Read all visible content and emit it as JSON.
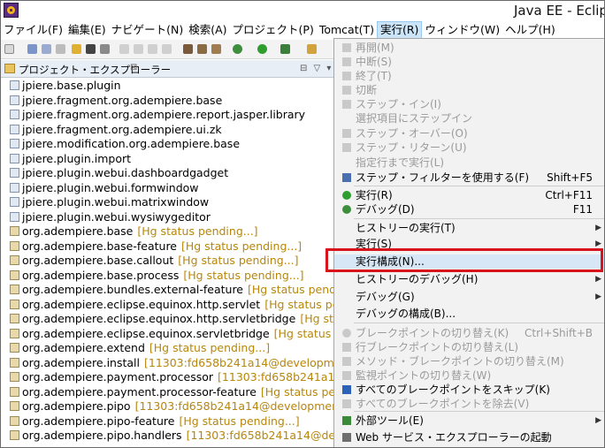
{
  "window": {
    "title": "Java EE - Eclip"
  },
  "menubar": [
    "ファイル(F)",
    "編集(E)",
    "ナビゲート(N)",
    "検索(A)",
    "プロジェクト(P)",
    "Tomcat(T)",
    "実行(R)",
    "ウィンドウ(W)",
    "ヘルプ(H)"
  ],
  "view": {
    "title": "プロジェクト・エクスプローラー",
    "close": "⊠",
    "tools": "⊟ ▽ ▾"
  },
  "tree": [
    {
      "name": "jpiere.base.plugin",
      "status": ""
    },
    {
      "name": "jpiere.fragment.org.adempiere.base",
      "status": ""
    },
    {
      "name": "jpiere.fragment.org.adempiere.report.jasper.library",
      "status": ""
    },
    {
      "name": "jpiere.fragment.org.adempiere.ui.zk",
      "status": ""
    },
    {
      "name": "jpiere.modification.org.adempiere.base",
      "status": ""
    },
    {
      "name": "jpiere.plugin.import",
      "status": ""
    },
    {
      "name": "jpiere.plugin.webui.dashboardgadget",
      "status": ""
    },
    {
      "name": "jpiere.plugin.webui.formwindow",
      "status": ""
    },
    {
      "name": "jpiere.plugin.webui.matrixwindow",
      "status": ""
    },
    {
      "name": "jpiere.plugin.webui.wysiwygeditor",
      "status": ""
    },
    {
      "name": "org.adempiere.base",
      "status": "[Hg status pending...]"
    },
    {
      "name": "org.adempiere.base-feature",
      "status": "[Hg status pending...]"
    },
    {
      "name": "org.adempiere.base.callout",
      "status": "[Hg status pending...]"
    },
    {
      "name": "org.adempiere.base.process",
      "status": "[Hg status pending...]"
    },
    {
      "name": "org.adempiere.bundles.external-feature",
      "status": "[Hg status pending"
    },
    {
      "name": "org.adempiere.eclipse.equinox.http.servlet",
      "status": "[Hg status pendi"
    },
    {
      "name": "org.adempiere.eclipse.equinox.http.servletbridge",
      "status": "[Hg status"
    },
    {
      "name": "org.adempiere.eclipse.equinox.servletbridge",
      "status": "[Hg status pendi"
    },
    {
      "name": "org.adempiere.extend",
      "status": "[Hg status pending...]"
    },
    {
      "name": "org.adempiere.install",
      "status": "[11303:fd658b241a14@development"
    },
    {
      "name": "org.adempiere.payment.processor",
      "status": "[11303:fd658b241a14@d"
    },
    {
      "name": "org.adempiere.payment.processor-feature",
      "status": "[Hg status pend"
    },
    {
      "name": "org.adempiere.pipo",
      "status": "[11303:fd658b241a14@development]"
    },
    {
      "name": "org.adempiere.pipo-feature",
      "status": "[Hg status pending...]"
    },
    {
      "name": "org.adempiere.pipo.handlers",
      "status": "[11303:fd658b241a14@devel"
    }
  ],
  "run_menu": [
    {
      "label": "再開(M)",
      "shortcut": "",
      "submenu": false,
      "disabled": true,
      "icon": "resume-icon"
    },
    {
      "label": "中断(S)",
      "shortcut": "",
      "submenu": false,
      "disabled": true,
      "icon": "suspend-icon"
    },
    {
      "label": "終了(T)",
      "shortcut": "",
      "submenu": false,
      "disabled": true,
      "icon": "terminate-icon"
    },
    {
      "label": "切断",
      "shortcut": "",
      "submenu": false,
      "disabled": true,
      "icon": "disconnect-icon"
    },
    {
      "label": "ステップ・イン(I)",
      "shortcut": "",
      "submenu": false,
      "disabled": true,
      "icon": "step-into-icon"
    },
    {
      "label": "選択項目にステップイン",
      "shortcut": "",
      "submenu": false,
      "disabled": true,
      "icon": ""
    },
    {
      "label": "ステップ・オーバー(O)",
      "shortcut": "",
      "submenu": false,
      "disabled": true,
      "icon": "step-over-icon"
    },
    {
      "label": "ステップ・リターン(U)",
      "shortcut": "",
      "submenu": false,
      "disabled": true,
      "icon": "step-return-icon"
    },
    {
      "label": "指定行まで実行(L)",
      "shortcut": "",
      "submenu": false,
      "disabled": true,
      "icon": ""
    },
    {
      "label": "ステップ・フィルターを使用する(F)",
      "shortcut": "Shift+F5",
      "submenu": false,
      "disabled": false,
      "icon": "step-filter-icon"
    },
    {
      "label": "実行(R)",
      "shortcut": "Ctrl+F11",
      "submenu": false,
      "disabled": false,
      "icon": "run-icon"
    },
    {
      "label": "デバッグ(D)",
      "shortcut": "F11",
      "submenu": false,
      "disabled": false,
      "icon": "debug-icon"
    },
    {
      "label": "ヒストリーの実行(T)",
      "shortcut": "",
      "submenu": true,
      "disabled": false,
      "icon": ""
    },
    {
      "label": "実行(S)",
      "shortcut": "",
      "submenu": true,
      "disabled": false,
      "icon": ""
    },
    {
      "label": "実行構成(N)...",
      "shortcut": "",
      "submenu": false,
      "disabled": false,
      "icon": ""
    },
    {
      "label": "ヒストリーのデバッグ(H)",
      "shortcut": "",
      "submenu": true,
      "disabled": false,
      "icon": ""
    },
    {
      "label": "デバッグ(G)",
      "shortcut": "",
      "submenu": true,
      "disabled": false,
      "icon": ""
    },
    {
      "label": "デバッグの構成(B)...",
      "shortcut": "",
      "submenu": false,
      "disabled": false,
      "icon": ""
    },
    {
      "label": "ブレークポイントの切り替え(K)",
      "shortcut": "Ctrl+Shift+B",
      "submenu": false,
      "disabled": true,
      "icon": "breakpoint-icon"
    },
    {
      "label": "行ブレークポイントの切り替え(L)",
      "shortcut": "",
      "submenu": false,
      "disabled": true,
      "icon": "line-breakpoint-icon"
    },
    {
      "label": "メソッド・ブレークポイントの切り替え(M)",
      "shortcut": "",
      "submenu": false,
      "disabled": true,
      "icon": "method-breakpoint-icon"
    },
    {
      "label": "監視ポイントの切り替え(W)",
      "shortcut": "",
      "submenu": false,
      "disabled": true,
      "icon": "watchpoint-icon"
    },
    {
      "label": "すべてのブレークポイントをスキップ(K)",
      "shortcut": "",
      "submenu": false,
      "disabled": false,
      "icon": "skip-breakpoints-icon"
    },
    {
      "label": "すべてのブレークポイントを除去(V)",
      "shortcut": "",
      "submenu": false,
      "disabled": true,
      "icon": "remove-breakpoints-icon"
    },
    {
      "label": "外部ツール(E)",
      "shortcut": "",
      "submenu": true,
      "disabled": false,
      "icon": "external-tools-icon"
    },
    {
      "label": "Web サービス・エクスプローラーの起動",
      "shortcut": "",
      "submenu": false,
      "disabled": false,
      "icon": "web-services-icon"
    }
  ],
  "colors": {
    "highlight": "#d9131b",
    "menu_bg": "#f2f2f2",
    "status_text": "#b8860b"
  }
}
